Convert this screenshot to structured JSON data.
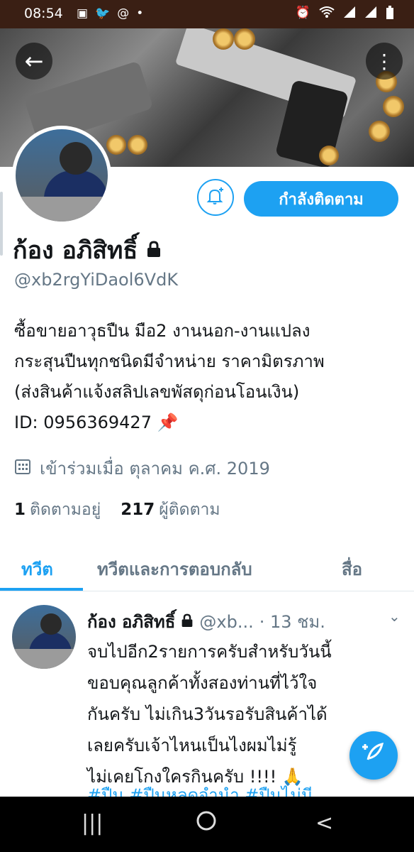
{
  "status_bar": {
    "time": "08:54",
    "left_icons": [
      "image-icon",
      "twitter-icon",
      "at-icon",
      "dot-icon"
    ],
    "right_icons": [
      "alarm-icon",
      "wifi-icon",
      "signal-icon",
      "signal-icon",
      "battery-icon"
    ]
  },
  "header": {
    "back_icon": "arrow-left-icon",
    "more_icon": "more-vertical-icon"
  },
  "profile": {
    "name": "ก้อง อภิสิทธิ์",
    "lock_icon": "lock-icon",
    "handle": "@xb2rgYiDaol6VdK",
    "bio": [
      "ซื้อขายอาวุธปืน มือ2 งานนอก-งานแปลง",
      "กระสุนปืนทุกชนิดมีจำหน่าย ราคามิตรภาพ",
      "(ส่งสินค้าแจ้งสลิปเลขพัสดุก่อนโอนเงิน)",
      "ID: 0956369427 📌"
    ],
    "joined": "เข้าร่วมเมื่อ ตุลาคม ค.ศ. 2019",
    "following_count": "1",
    "following_label": "ติดตามอยู่",
    "followers_count": "217",
    "followers_label": "ผู้ติดตาม"
  },
  "actions": {
    "follow_label": "กำลังติดตาม",
    "notify_icon": "bell-plus-icon"
  },
  "tabs": [
    {
      "label": "ทวีต",
      "active": true
    },
    {
      "label": "ทวีตและการตอบกลับ",
      "active": false
    },
    {
      "label": "สื่อ",
      "active": false
    }
  ],
  "tweet": {
    "name": "ก้อง อภิสิทธิ์",
    "handle": "@xb...",
    "time": "· 13 ชม.",
    "lines": [
      "จบไปอีก2รายการครับสำหรับวันนี้",
      "ขอบคุณลูกค้าทั้งสองท่านที่ไว้ใจ",
      "กันครับ ไม่เกิน3วันรอรับสินค้าได้",
      "เลยครับเจ้าไหนเป็นไงผมไม่รู้",
      "ไม่เคยโกงใครกินครับ !!!! 🙏"
    ],
    "hashtags": "#ปืน #ปืนหลุดจำนำ #ปืนไม่มี"
  },
  "compose_icon": "feather-plus-icon",
  "nav_bar": {
    "recents_icon": "recents-icon",
    "home_icon": "home-icon",
    "back_icon": "back-chevron-icon"
  },
  "colors": {
    "accent": "#1da1f2",
    "secondary_text": "#657786",
    "status_bar_bg": "#3a1f14"
  }
}
